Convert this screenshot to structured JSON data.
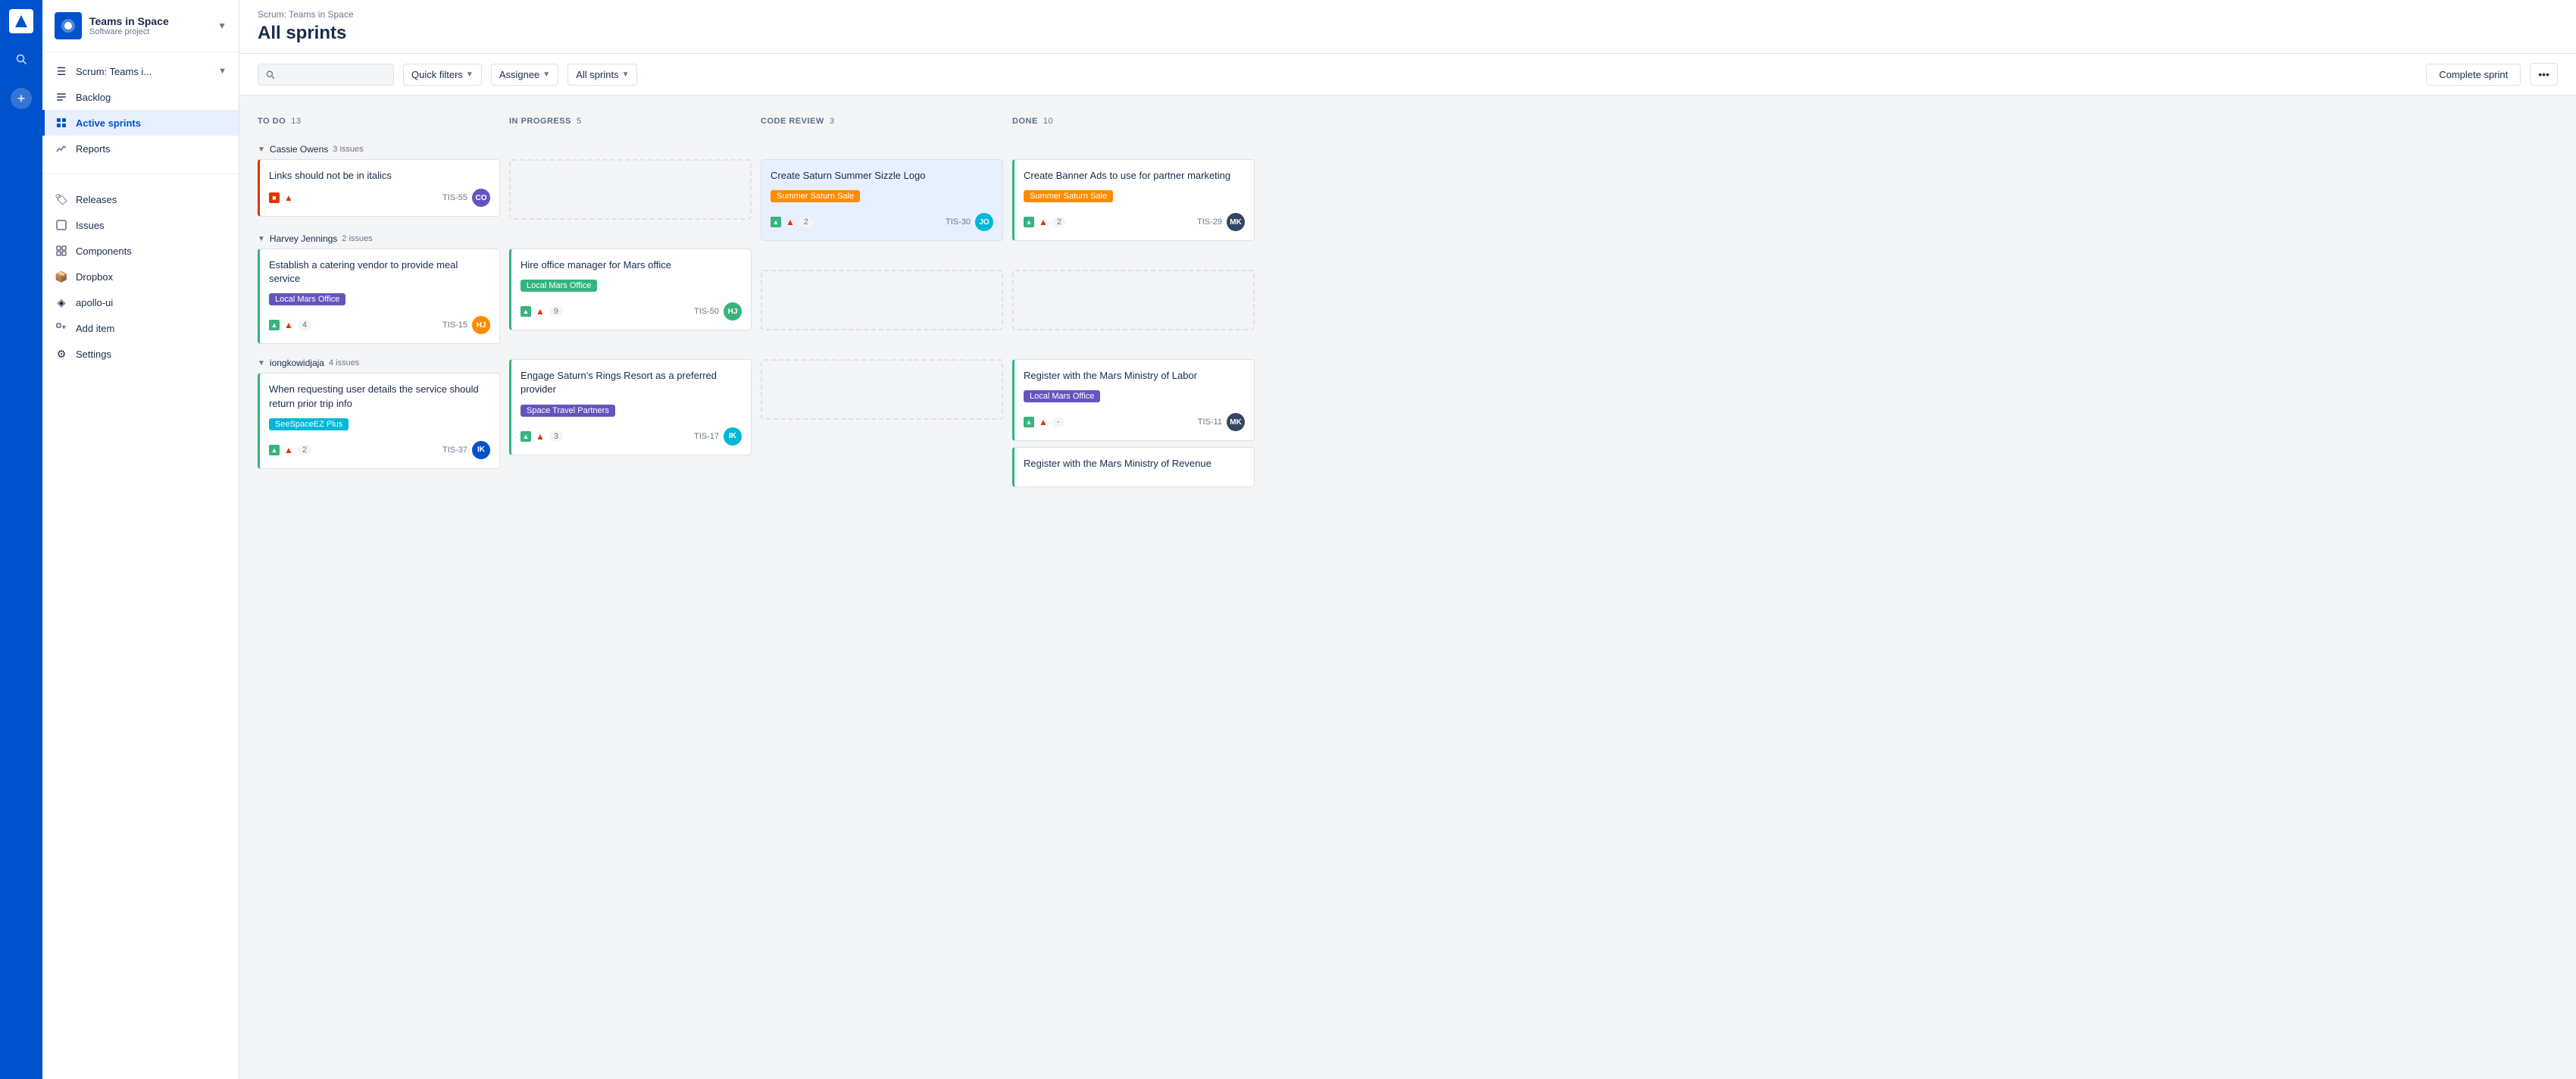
{
  "app": {
    "name": "Teams in Space Software project"
  },
  "iconbar": {
    "logo": "✦",
    "search_icon": "⌕",
    "plus_icon": "+"
  },
  "sidebar": {
    "project_name": "Teams in Space",
    "project_subtitle": "Software project",
    "nav_items": [
      {
        "id": "scrum",
        "label": "Scrum: Teams i...",
        "icon": "☰",
        "has_chevron": true
      },
      {
        "id": "backlog",
        "label": "Backlog",
        "icon": "≡"
      },
      {
        "id": "active-sprints",
        "label": "Active sprints",
        "icon": "⊞",
        "active": true
      },
      {
        "id": "reports",
        "label": "Reports",
        "icon": "📊"
      }
    ],
    "secondary_items": [
      {
        "id": "releases",
        "label": "Releases",
        "icon": "🏷"
      },
      {
        "id": "issues",
        "label": "Issues",
        "icon": "⊡"
      },
      {
        "id": "components",
        "label": "Components",
        "icon": "⊞"
      },
      {
        "id": "dropbox",
        "label": "Dropbox",
        "icon": "📦"
      },
      {
        "id": "apollo-ui",
        "label": "apollo-ui",
        "icon": "◈"
      },
      {
        "id": "add-item",
        "label": "Add item",
        "icon": "+"
      },
      {
        "id": "settings",
        "label": "Settings",
        "icon": "⚙"
      }
    ]
  },
  "topbar": {
    "breadcrumb": "Scrum: Teams in Space",
    "title": "All sprints"
  },
  "toolbar": {
    "search_placeholder": "",
    "filters": [
      {
        "id": "quick-filters",
        "label": "Quick filters"
      },
      {
        "id": "assignee",
        "label": "Assignee"
      },
      {
        "id": "all-sprints",
        "label": "All sprints"
      }
    ],
    "complete_sprint_label": "Complete sprint",
    "more_label": "..."
  },
  "columns": [
    {
      "id": "todo",
      "title": "TO DO",
      "count": 13
    },
    {
      "id": "inprogress",
      "title": "IN PROGRESS",
      "count": 5
    },
    {
      "id": "codereview",
      "title": "CODE REVIEW",
      "count": 3
    },
    {
      "id": "done",
      "title": "DONE",
      "count": 10
    }
  ],
  "swimlanes": [
    {
      "id": "cassie",
      "name": "Cassie Owens",
      "issue_count": "3 issues",
      "cards": {
        "todo": [
          {
            "id": "TIS-55",
            "title": "Links should not be in italics",
            "tag": null,
            "border": "red",
            "icon_type": "red",
            "priority": "high",
            "count": null,
            "avatar_color": "purple",
            "avatar_initials": "CO"
          }
        ],
        "inprogress": [],
        "codereview": [
          {
            "id": "TIS-30",
            "title": "Create Saturn Summer Sizzle Logo",
            "tag": "Summer Saturn Sale",
            "tag_color": "orange",
            "border": "green",
            "icon_type": "green",
            "priority": "high",
            "count": "2",
            "avatar_color": "teal",
            "avatar_initials": "JO",
            "highlight": true
          }
        ],
        "done": [
          {
            "id": "TIS-29",
            "title": "Create Banner Ads to use for partner marketing",
            "tag": "Summer Saturn Sale",
            "tag_color": "orange",
            "border": "green",
            "icon_type": "green",
            "priority": "high",
            "count": "2",
            "avatar_color": "dark",
            "avatar_initials": "MK"
          }
        ]
      }
    },
    {
      "id": "harvey",
      "name": "Harvey Jennings",
      "issue_count": "2 issues",
      "cards": {
        "todo": [
          {
            "id": "TIS-15",
            "title": "Establish a catering vendor to provide meal service",
            "tag": "Local Mars Office",
            "tag_color": "purple",
            "border": "green",
            "icon_type": "green",
            "priority": "high",
            "count": "4",
            "avatar_color": "orange",
            "avatar_initials": "HJ"
          }
        ],
        "inprogress": [
          {
            "id": "TIS-50",
            "title": "Hire office manager for Mars office",
            "tag": "Local Mars Office",
            "tag_color": "green",
            "border": "green",
            "icon_type": "green",
            "priority": "high",
            "count": "9",
            "avatar_color": "green",
            "avatar_initials": "HJ"
          }
        ],
        "codereview": [],
        "done": []
      }
    },
    {
      "id": "iong",
      "name": "iongkowidjaja",
      "issue_count": "4 issues",
      "cards": {
        "todo": [
          {
            "id": "TIS-37",
            "title": "When requesting user details the service should return prior trip info",
            "tag": "SeeSpaceEZ Plus",
            "tag_color": "teal",
            "border": "green",
            "icon_type": "green",
            "priority": "high",
            "count": "2",
            "avatar_color": "blue",
            "avatar_initials": "IK"
          }
        ],
        "inprogress": [
          {
            "id": "TIS-17",
            "title": "Engage Saturn's Rings Resort as a preferred provider",
            "tag": "Space Travel Partners",
            "tag_color": "purple",
            "border": "green",
            "icon_type": "green",
            "priority": "high",
            "count": "3",
            "avatar_color": "teal",
            "avatar_initials": "IK"
          }
        ],
        "codereview": [],
        "done": [
          {
            "id": "TIS-11",
            "title": "Register with the Mars Ministry of Labor",
            "tag": "Local Mars Office",
            "tag_color": "purple",
            "border": "green",
            "icon_type": "green",
            "priority": "high",
            "count": "-",
            "avatar_color": "dark",
            "avatar_initials": "MK"
          },
          {
            "id": null,
            "title": "Register with the Mars Ministry of Revenue",
            "tag": null,
            "border": "green",
            "icon_type": "green",
            "priority": null,
            "count": null,
            "avatar_color": null,
            "avatar_initials": null,
            "partial": true
          }
        ]
      }
    }
  ]
}
